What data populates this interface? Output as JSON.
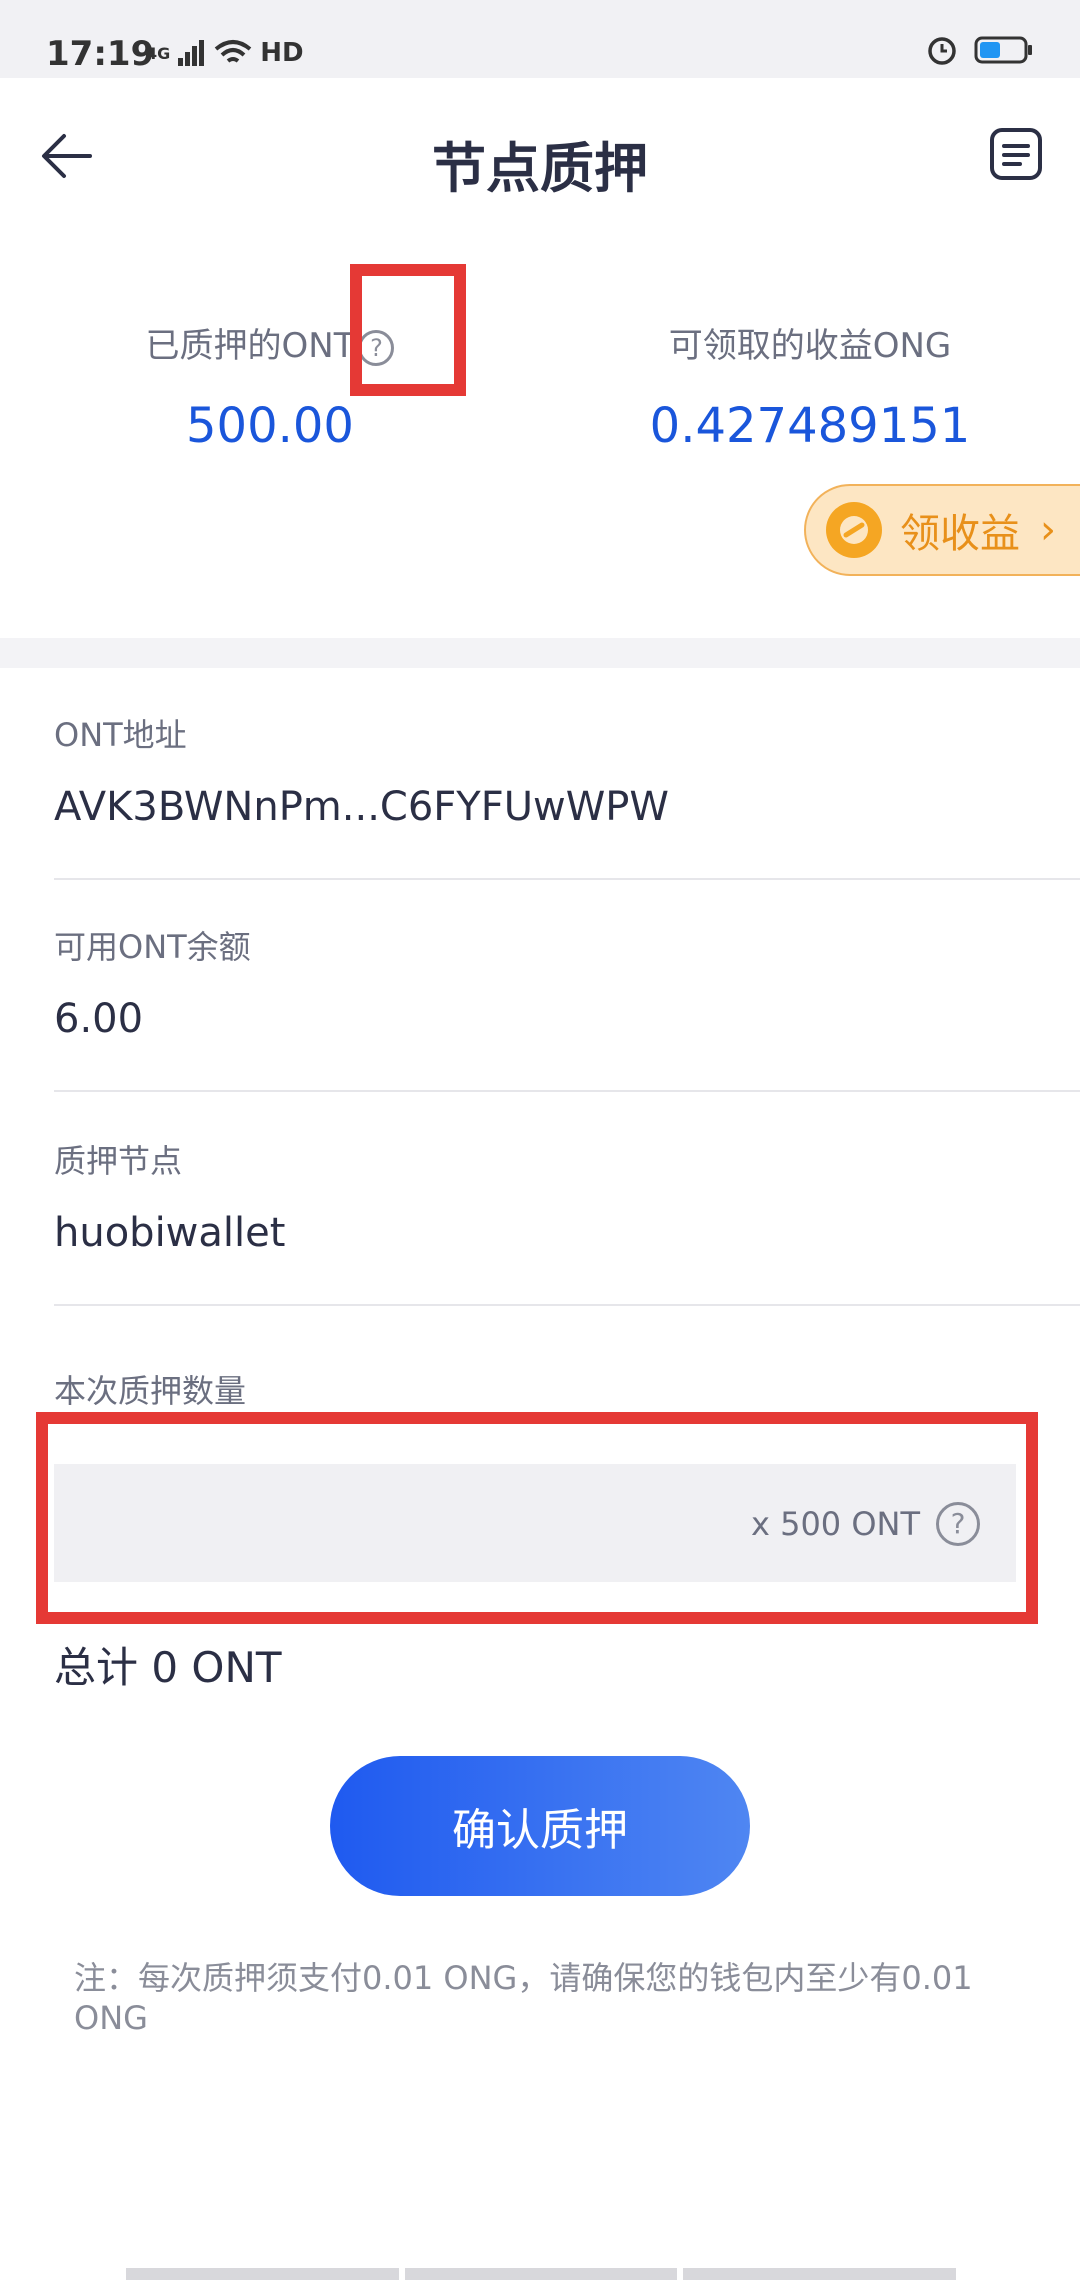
{
  "status_bar": {
    "time": "17:19",
    "network": "4G",
    "hd": "HD"
  },
  "header": {
    "title": "节点质押"
  },
  "summary": {
    "staked_label": "已质押的ONT",
    "staked_value": "500.00",
    "reward_label": "可领取的收益ONG",
    "reward_value": "0.427489151",
    "claim_label": "领收益"
  },
  "fields": {
    "address_label": "ONT地址",
    "address_value": "AVK3BWNnPm...C6FYFUwWPW",
    "balance_label": "可用ONT余额",
    "balance_value": "6.00",
    "node_label": "质押节点",
    "node_value": "huobiwallet",
    "amount_label": "本次质押数量",
    "amount_value": "",
    "amount_suffix": "x 500 ONT"
  },
  "total": "总计 0 ONT",
  "confirm_label": "确认质押",
  "note": "注：每次质押须支付0.01 ONG，请确保您的钱包内至少有0.01 ONG",
  "colors": {
    "accent": "#1a56db",
    "highlight": "#e53935",
    "claim_bg": "#fde6c3",
    "claim_text": "#e8901a"
  }
}
